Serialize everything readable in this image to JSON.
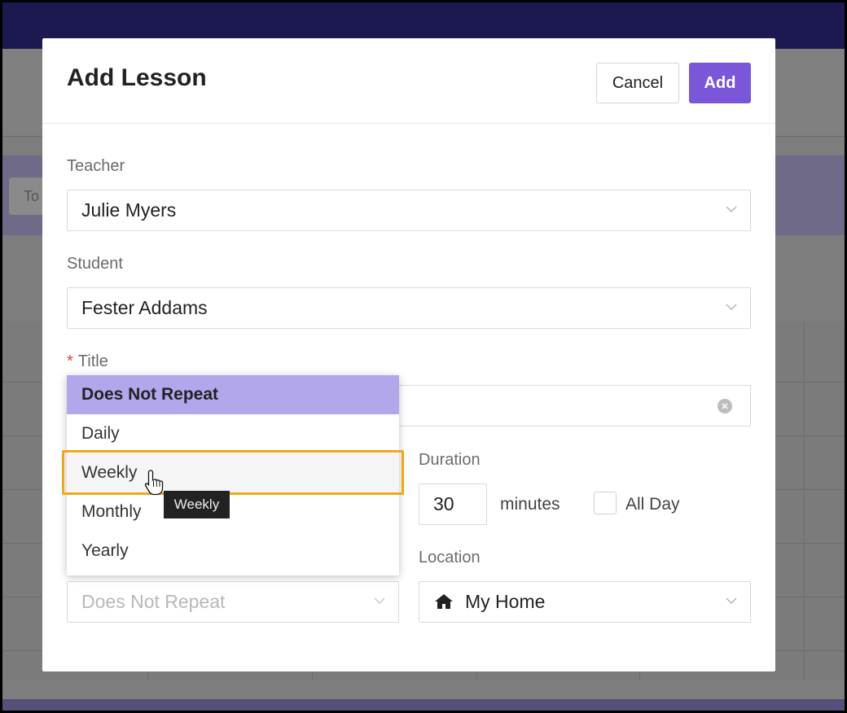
{
  "background_app": {
    "today_button": "To"
  },
  "modal": {
    "title": "Add Lesson",
    "cancel_label": "Cancel",
    "add_label": "Add",
    "teacher": {
      "label": "Teacher",
      "value": "Julie Myers"
    },
    "student": {
      "label": "Student",
      "value": "Fester Addams"
    },
    "title_field": {
      "required_mark": "*",
      "label": "Title"
    },
    "duration": {
      "label": "Duration",
      "value": "30",
      "unit": "minutes",
      "all_day_label": "All Day",
      "all_day_checked": false
    },
    "repeat": {
      "value": "Does Not Repeat"
    },
    "location": {
      "label": "Location",
      "value": "My Home",
      "icon": "home-icon"
    }
  },
  "repeat_dropdown": {
    "options": [
      "Does Not Repeat",
      "Daily",
      "Weekly",
      "Monthly",
      "Yearly"
    ],
    "selected": "Does Not Repeat",
    "hovered": "Weekly",
    "tooltip": "Weekly"
  },
  "colors": {
    "accent": "#7b56d8",
    "selected_option": "#b3a7ec",
    "highlight": "#f0a814",
    "required": "#e04040"
  }
}
